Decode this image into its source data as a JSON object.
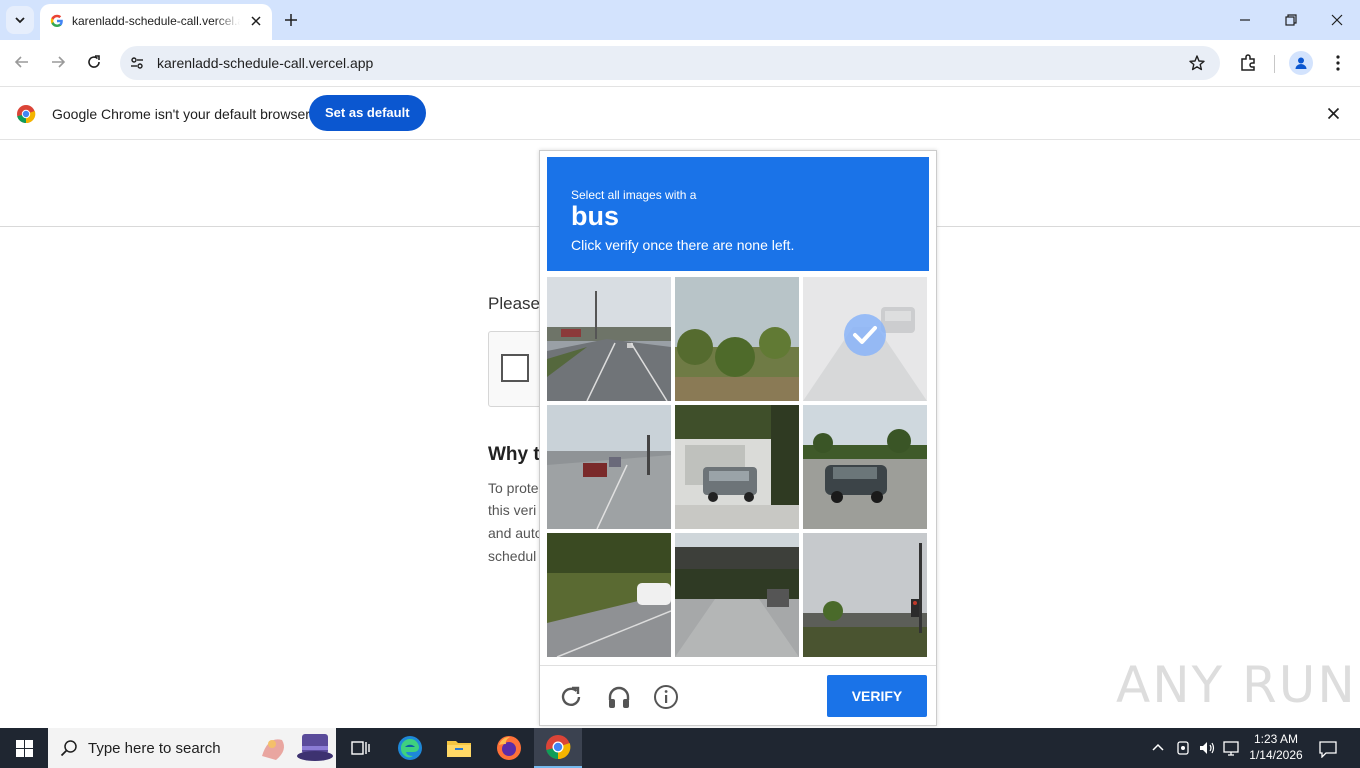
{
  "browser": {
    "tab_title": "karenladd-schedule-call.vercel.app",
    "url": "karenladd-schedule-call.vercel.app",
    "infobar_message": "Google Chrome isn't your default browser",
    "infobar_button": "Set as default"
  },
  "page": {
    "prompt_partial": "Please",
    "why_heading_partial": "Why t",
    "why_lines": [
      "To prote",
      "this veri",
      "and auto",
      "schedul"
    ]
  },
  "captcha": {
    "line1": "Select all images with a",
    "target": "bus",
    "line3": "Click verify once there are none left.",
    "verify_label": "VERIFY",
    "tiles": [
      {
        "label": "road with traffic",
        "selected": false
      },
      {
        "label": "trees and sky",
        "selected": false
      },
      {
        "label": "highway in fog",
        "selected": true
      },
      {
        "label": "street with cars",
        "selected": false
      },
      {
        "label": "parked car by building",
        "selected": false
      },
      {
        "label": "car on road",
        "selected": false
      },
      {
        "label": "road edge with car",
        "selected": false
      },
      {
        "label": "overpass",
        "selected": false
      },
      {
        "label": "bridge and traffic light",
        "selected": false
      }
    ],
    "accent": "#1a73e8"
  },
  "watermark": "ANY RUN",
  "taskbar": {
    "search_placeholder": "Type here to search",
    "time": "1:23 AM",
    "date": "1/14/2026"
  }
}
